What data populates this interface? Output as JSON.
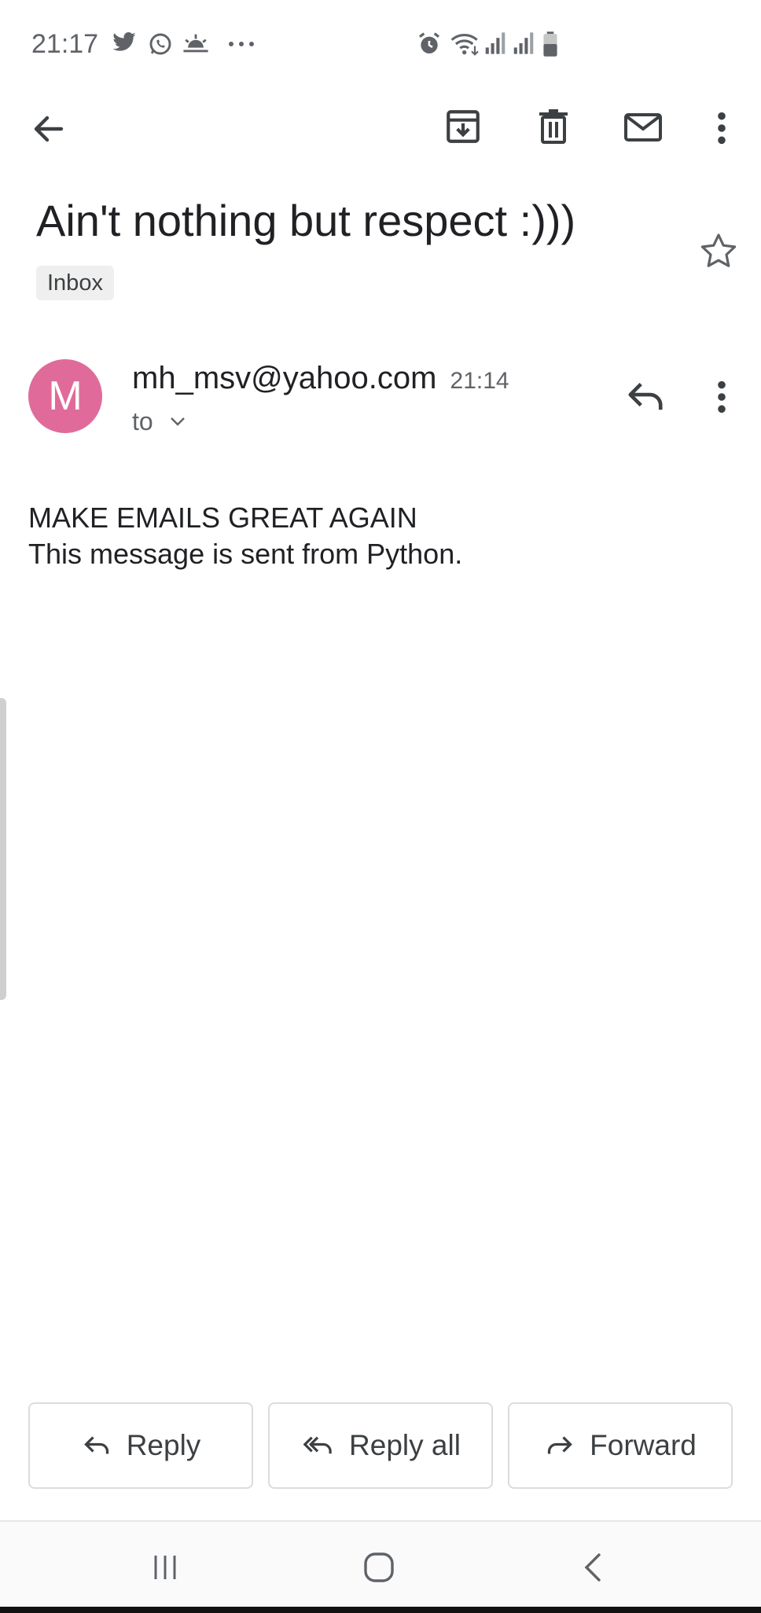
{
  "status_bar": {
    "time": "21:17",
    "left_icons": [
      "twitter-icon",
      "whatsapp-icon",
      "sunrise-icon",
      "more-notifications-icon"
    ],
    "right_icons": [
      "alarm-icon",
      "wifi-icon",
      "signal-1-icon",
      "signal-2-icon",
      "battery-icon"
    ]
  },
  "app_bar": {
    "icons": [
      "back-arrow-icon",
      "archive-icon",
      "delete-icon",
      "mark-unread-icon",
      "more-vert-icon"
    ]
  },
  "email": {
    "subject": "Ain't nothing but respect :)))",
    "label": "Inbox",
    "avatar_letter": "M",
    "avatar_color": "#e06b9a",
    "sender": "mh_msv@yahoo.com",
    "time": "21:14",
    "to_text": "to",
    "body_line1": "MAKE EMAILS GREAT AGAIN",
    "body_line2": "This message is sent from Python."
  },
  "actions": {
    "reply": "Reply",
    "reply_all": "Reply all",
    "forward": "Forward"
  },
  "nav": {
    "icons": [
      "recent-apps-icon",
      "home-icon",
      "back-icon"
    ]
  }
}
